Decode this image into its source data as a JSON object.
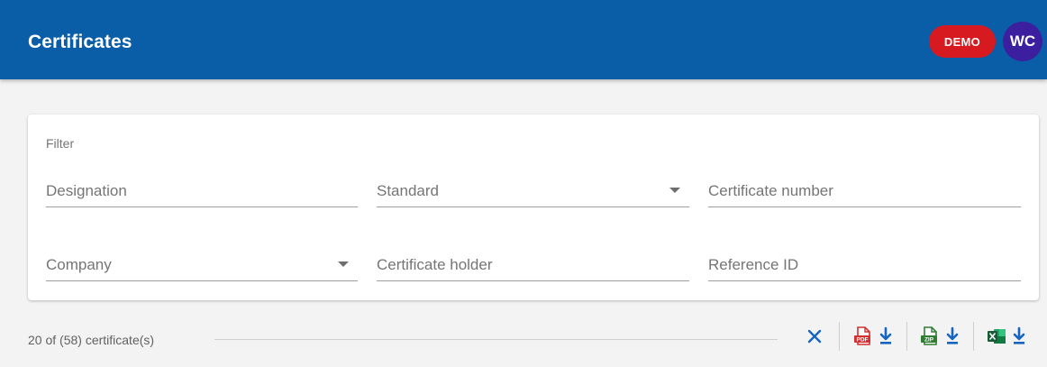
{
  "header": {
    "title": "Certificates",
    "demo_badge": "DEMO",
    "avatar_initials": "WC"
  },
  "filter": {
    "label": "Filter",
    "fields": {
      "designation": "Designation",
      "standard": "Standard",
      "certificate_number": "Certificate number",
      "company": "Company",
      "certificate_holder": "Certificate holder",
      "reference_id": "Reference ID"
    }
  },
  "results": {
    "count_text": "20 of (58) certificate(s)"
  },
  "icons": {
    "clear": "close-icon",
    "pdf": "pdf-file-icon",
    "zip": "zip-file-icon",
    "excel": "excel-file-icon",
    "download": "download-arrow-icon"
  },
  "colors": {
    "header_bg": "#0a5ea8",
    "demo_badge": "#d71920",
    "avatar": "#3b1f9e",
    "action_blue": "#1565c0",
    "pdf_red": "#d32f2f",
    "zip_green": "#2e7d32",
    "excel_green": "#1d8f47"
  }
}
